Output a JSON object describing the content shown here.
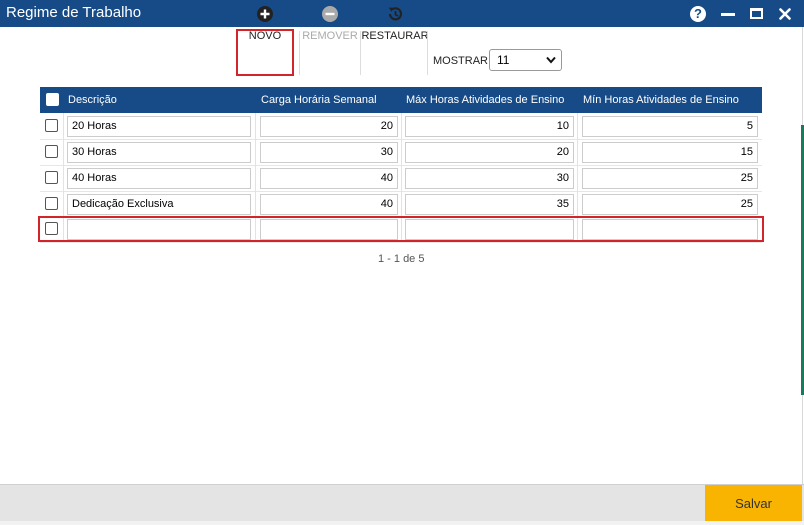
{
  "window": {
    "title": "Regime de Trabalho",
    "help_glyph": "?",
    "icons": [
      "help-icon",
      "minimize-icon",
      "maximize-icon",
      "close-icon"
    ]
  },
  "toolbar": {
    "new_label": "NOVO",
    "remove_label": "REMOVER",
    "restore_label": "RESTAURAR",
    "show_label": "MOSTRAR:",
    "page_size_value": "11"
  },
  "grid": {
    "columns": [
      "Descrição",
      "Carga Horária Semanal",
      "Máx Horas Atividades de Ensino",
      "Mín Horas Atividades de Ensino"
    ],
    "rows": [
      {
        "descricao": "20 Horas",
        "carga": "20",
        "max": "10",
        "min": "5"
      },
      {
        "descricao": "30 Horas",
        "carga": "30",
        "max": "20",
        "min": "15"
      },
      {
        "descricao": "40 Horas",
        "carga": "40",
        "max": "30",
        "min": "25"
      },
      {
        "descricao": "Dedicação Exclusiva",
        "carga": "40",
        "max": "35",
        "min": "25"
      },
      {
        "descricao": "",
        "carga": "",
        "max": "",
        "min": ""
      }
    ],
    "pagination": "1 - 1 de 5"
  },
  "footer": {
    "save_label": "Salvar"
  },
  "colors": {
    "header_blue": "#174b87",
    "highlight_red": "#d3242b",
    "save_yellow": "#f8b400"
  }
}
